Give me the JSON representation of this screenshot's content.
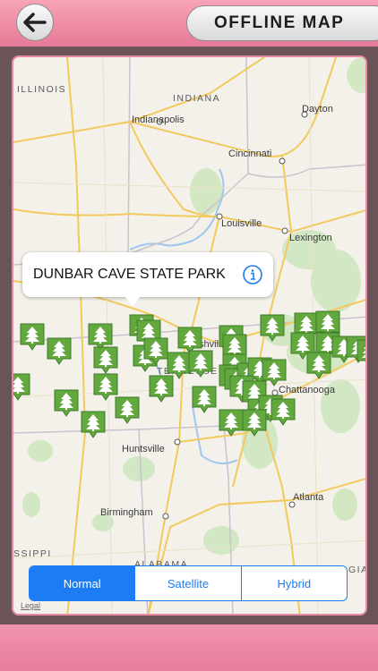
{
  "header": {
    "back_icon": "arrow-left-icon",
    "title": "OFFLINE MAP"
  },
  "map": {
    "callout": {
      "title": "DUNBAR CAVE STATE PARK",
      "info_icon": "info-icon"
    },
    "states": {
      "illinois": "ILLINOIS",
      "indiana": "INDIANA",
      "tennessee": "TENNESSEE",
      "alabama": "ALABAMA",
      "mississippi": "SSIPPI",
      "georgia": "GIA"
    },
    "cities": {
      "indianapolis": "Indianapolis",
      "dayton": "Dayton",
      "cincinnati": "Cincinnati",
      "louisville": "Louisville",
      "lexington": "Lexington",
      "nashville": "Nashville",
      "chattanooga": "Chattanooga",
      "huntsville": "Huntsville",
      "birmingham": "Birmingham",
      "atlanta": "Atlanta"
    },
    "pin_icon": "tree-marker-icon",
    "legal": "Legal"
  },
  "map_type": {
    "options": [
      "Normal",
      "Satellite",
      "Hybrid"
    ],
    "selected": "Normal"
  },
  "colors": {
    "accent": "#1d7cf2",
    "pin_green": "#62a83f",
    "bar_pink": "#ee8ba6"
  }
}
